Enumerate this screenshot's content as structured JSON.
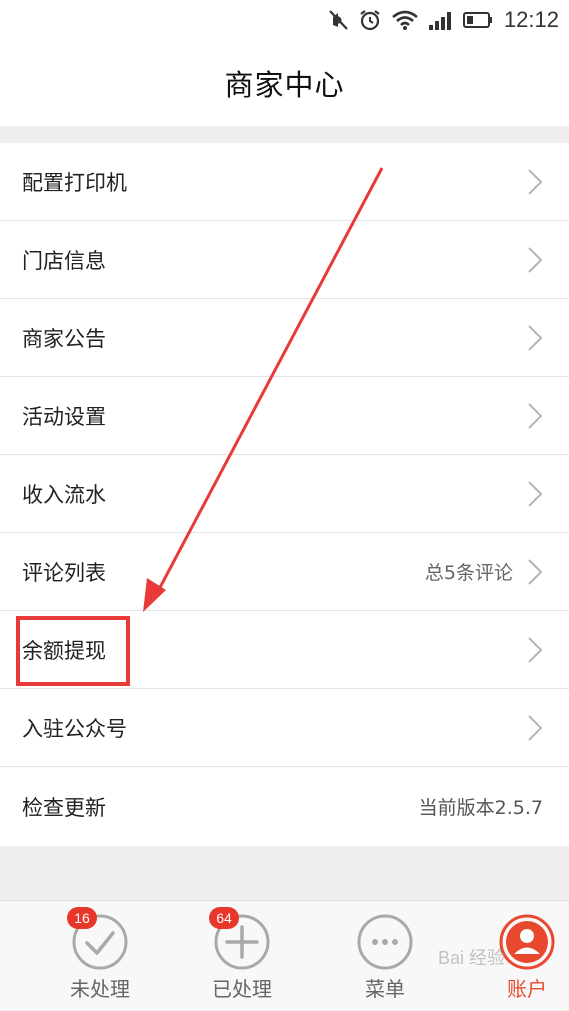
{
  "status_bar": {
    "time": "12:12"
  },
  "header": {
    "title": "商家中心"
  },
  "menu": [
    {
      "label": "配置打印机",
      "value": ""
    },
    {
      "label": "门店信息",
      "value": ""
    },
    {
      "label": "商家公告",
      "value": ""
    },
    {
      "label": "活动设置",
      "value": ""
    },
    {
      "label": "收入流水",
      "value": ""
    },
    {
      "label": "评论列表",
      "value": "总5条评论"
    },
    {
      "label": "余额提现",
      "value": ""
    },
    {
      "label": "入驻公众号",
      "value": ""
    },
    {
      "label": "检查更新",
      "value": "当前版本2.5.7"
    }
  ],
  "tabbar": {
    "tabs": [
      {
        "label": "未处理",
        "badge": "16",
        "icon": "check-circle-icon"
      },
      {
        "label": "已处理",
        "badge": "64",
        "icon": "plus-circle-icon"
      },
      {
        "label": "菜单",
        "badge": "",
        "icon": "more-circle-icon"
      },
      {
        "label": "账户",
        "badge": "",
        "icon": "user-icon"
      }
    ],
    "active_index": 3
  },
  "colors": {
    "accent": "#e8492e",
    "annotation": "#e83a3a"
  },
  "watermark": "Bai 经验"
}
